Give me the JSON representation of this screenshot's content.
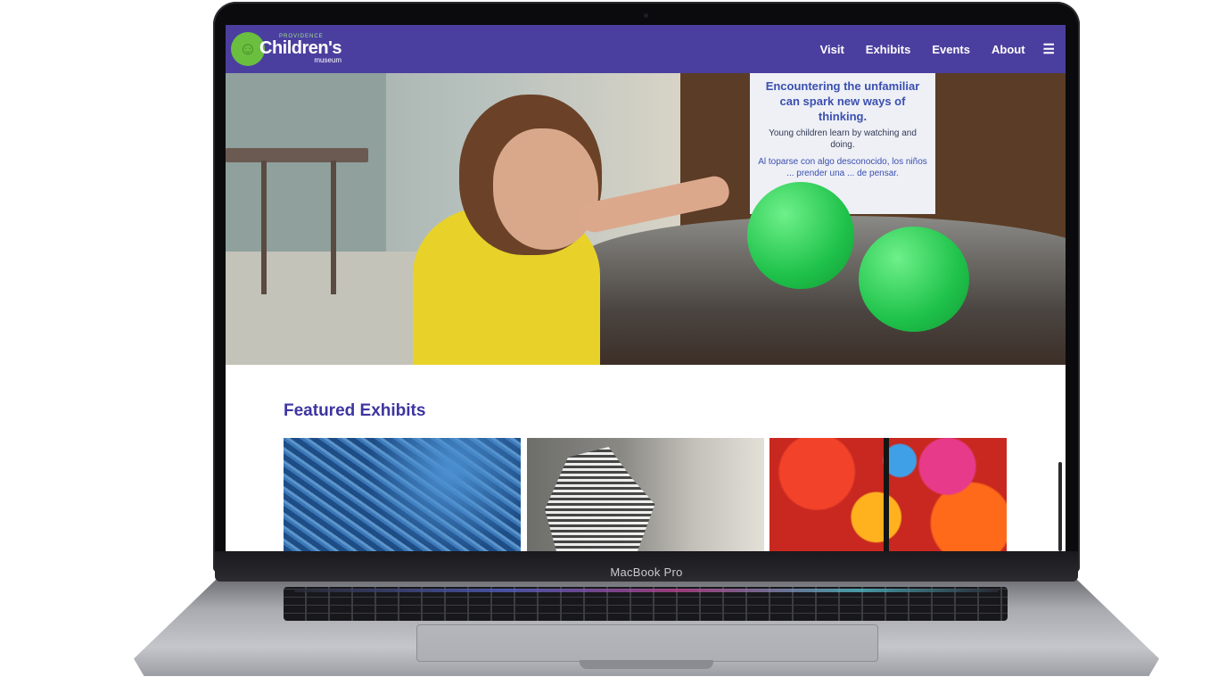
{
  "device": {
    "chin_label": "MacBook Pro"
  },
  "header": {
    "logo": {
      "top": "PROVIDENCE",
      "main": "Children's",
      "sub": "museum"
    },
    "nav": [
      "Visit",
      "Exhibits",
      "Events",
      "About"
    ],
    "menu_icon": "☰"
  },
  "hero": {
    "sign": {
      "heading": "Encountering the unfamiliar can spark new ways of thinking.",
      "english": "Young children learn by watching and doing.",
      "spanish": "Al toparse con algo desconocido, los niños ... prender una ... de pensar."
    }
  },
  "featured": {
    "title": "Featured Exhibits",
    "cards": [
      {
        "image": "city-model-photo"
      },
      {
        "image": "sculpture-photo"
      },
      {
        "image": "glass-art-ceiling-photo"
      }
    ]
  },
  "colors": {
    "brand": "#4a3f9f",
    "title": "#3d35a0",
    "logo_green": "#6abf3f"
  }
}
